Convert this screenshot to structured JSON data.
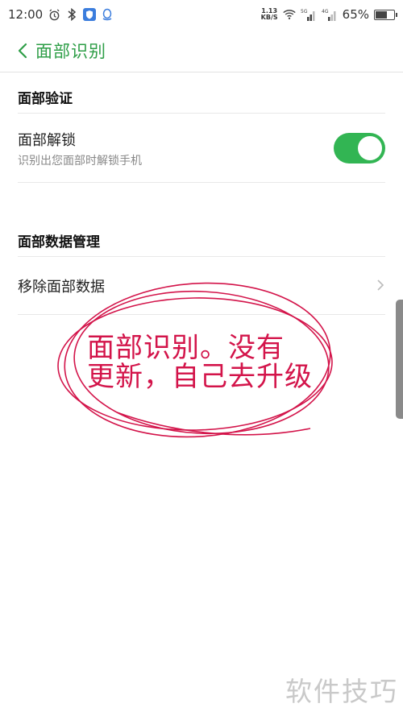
{
  "status_bar": {
    "time": "12:00",
    "speed_value": "1.13",
    "speed_unit": "KB/S",
    "sim1_label": "5G",
    "sim2_label": "4G",
    "battery": "65%",
    "battery_level": 0.65
  },
  "header": {
    "title": "面部识别"
  },
  "sections": {
    "verify": {
      "title": "面部验证",
      "unlock_title": "面部解锁",
      "unlock_subtitle": "识别出您面部时解锁手机",
      "unlock_enabled": true
    },
    "data": {
      "title": "面部数据管理",
      "remove_label": "移除面部数据"
    }
  },
  "annotation": {
    "line1": "面部识别。没有",
    "line2": "更新，自己去升级",
    "color": "#d3144a"
  },
  "watermark": "软件技巧",
  "colors": {
    "accent": "#2e9e47",
    "toggle_on": "#32b553"
  }
}
